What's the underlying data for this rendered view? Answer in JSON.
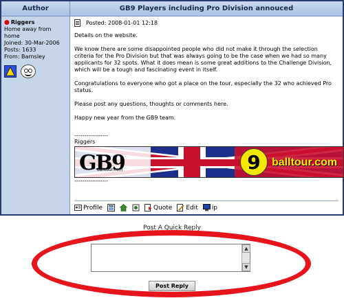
{
  "thread": {
    "author_header": "Author",
    "title": "GB9 Players including Pro Division annouced"
  },
  "author": {
    "name": "Riggers",
    "status_text": "Home away from home",
    "joined": "Joined: 30-Mar-2006",
    "posts": "Posts: 1633",
    "from": "From: Barnsley",
    "online_color": "#dd0000"
  },
  "post": {
    "posted": "Posted: 2008-01-01 12:18",
    "paragraphs": [
      "Details on the website.",
      "We know there are some disappointed people who did not make it through the selection criteria for the Pro Division but that was always going to be the case when we had so many applicants for 32 spots. What it does mean is some great additions to the Challenge Division, which will be a tough and fascinating event in itself.",
      "Congratulations to everyone who got a place on the tour, especially the 32 who achieved Pro status.",
      "Please post any questions, thoughts or comments here.",
      "Happy new year from the GB9 team."
    ],
    "sig_divider_top": "-----------------",
    "sig_name": "Riggers",
    "sig_divider_bottom": "-----------------",
    "banner": {
      "logo": "GB9",
      "logo_sub": "balltour.com",
      "ball_number": "9",
      "site": "balltour.com"
    }
  },
  "actions": {
    "profile": "Profile",
    "quote": "Quote",
    "edit": "Edit",
    "ip": "ip",
    "icons": [
      "profile-icon",
      "pm-icon",
      "home-icon",
      "bookmark-icon",
      "quote-icon",
      "edit-icon",
      "ip-icon"
    ]
  },
  "quick_reply": {
    "title": "Post A Quick Reply",
    "button": "Post Reply",
    "textarea_value": ""
  },
  "colors": {
    "header_bg": "#b5c9e8",
    "author_bg": "#c6d5ea",
    "highlight_ring": "#e8141b"
  }
}
